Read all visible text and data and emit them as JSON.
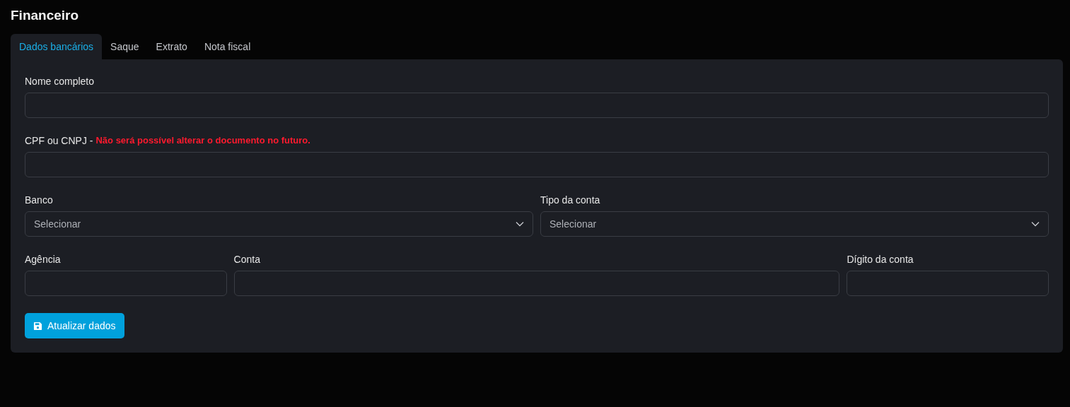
{
  "title": "Financeiro",
  "tabs": [
    {
      "label": "Dados bancários",
      "selected": true
    },
    {
      "label": "Saque",
      "selected": false
    },
    {
      "label": "Extrato",
      "selected": false
    },
    {
      "label": "Nota fiscal",
      "selected": false
    }
  ],
  "form": {
    "rows": [
      [
        {
          "kind": "text",
          "label": "Nome completo"
        }
      ],
      [
        {
          "kind": "text",
          "label": "CPF ou CNPJ -",
          "warning": "Não será possível alterar o documento no futuro."
        }
      ],
      [
        {
          "kind": "select",
          "label": "Banco",
          "value": "Selecionar"
        },
        {
          "kind": "select",
          "label": "Tipo da conta",
          "value": "Selecionar"
        }
      ],
      [
        {
          "kind": "text",
          "label": "Agência"
        },
        {
          "kind": "text",
          "label": "Conta"
        },
        {
          "kind": "text",
          "label": "Dígito da conta"
        }
      ]
    ],
    "submit_button": "Atualizar dados"
  }
}
